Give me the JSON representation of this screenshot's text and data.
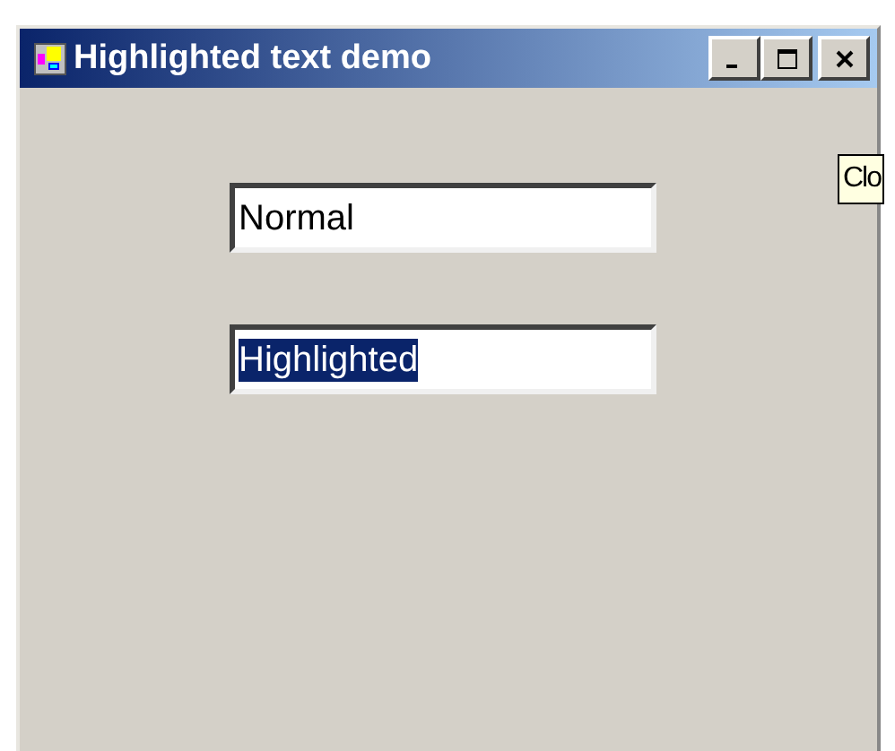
{
  "window": {
    "title": "Highlighted text demo"
  },
  "fields": [
    {
      "value": "Normal",
      "highlighted": false
    },
    {
      "value": "Highlighted",
      "highlighted": true
    }
  ],
  "tooltip": {
    "text": "Clo"
  }
}
